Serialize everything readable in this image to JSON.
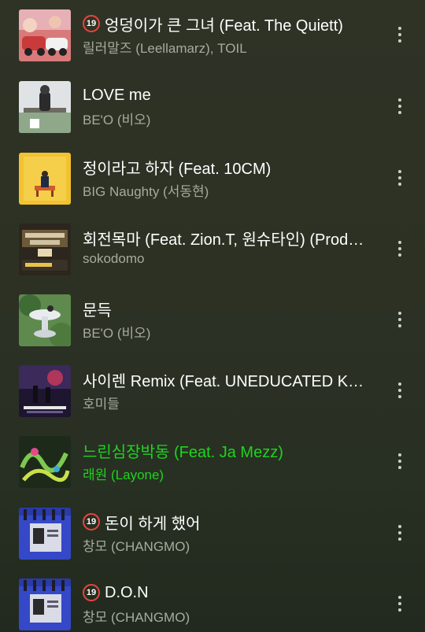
{
  "tracks": [
    {
      "title": "엉덩이가 큰 그녀 (Feat. The Quiett)",
      "artist": "릴러말즈 (Leellamarz), TOIL",
      "explicit": true,
      "playing": false,
      "art_icon": "cartoon-cars-art"
    },
    {
      "title": "LOVE me",
      "artist": "BE'O (비오)",
      "explicit": false,
      "playing": false,
      "art_icon": "singer-bench-art"
    },
    {
      "title": "정이라고 하자 (Feat. 10CM)",
      "artist": "BIG Naughty (서동현)",
      "explicit": false,
      "playing": false,
      "art_icon": "yellow-wall-art"
    },
    {
      "title": "회전목마 (Feat. Zion.T, 원슈타인) (Prod. Slom)",
      "artist": "sokodomo",
      "explicit": false,
      "playing": false,
      "art_icon": "show-me-the-money-art"
    },
    {
      "title": "문득",
      "artist": "BE'O (비오)",
      "explicit": false,
      "playing": false,
      "art_icon": "white-sculpture-art"
    },
    {
      "title": "사이렌 Remix (Feat. UNEDUCATED KID, Paul Blanco)",
      "artist": "호미들",
      "explicit": false,
      "playing": false,
      "art_icon": "siren-night-art"
    },
    {
      "title": "느린심장박동 (Feat. Ja Mezz)",
      "artist": "래원 (Layone)",
      "explicit": false,
      "playing": true,
      "art_icon": "green-graffiti-art"
    },
    {
      "title": "돈이 하게 했어",
      "artist": "창모 (CHANGMO)",
      "explicit": true,
      "playing": false,
      "art_icon": "blue-piano-art"
    },
    {
      "title": "D.O.N",
      "artist": "창모 (CHANGMO)",
      "explicit": true,
      "playing": false,
      "art_icon": "blue-piano-art"
    }
  ],
  "explicit_badge_label": "19",
  "colors": {
    "playing": "#1ed41e",
    "badge_ring": "#e8453c",
    "artist": "#a7ab9e"
  }
}
